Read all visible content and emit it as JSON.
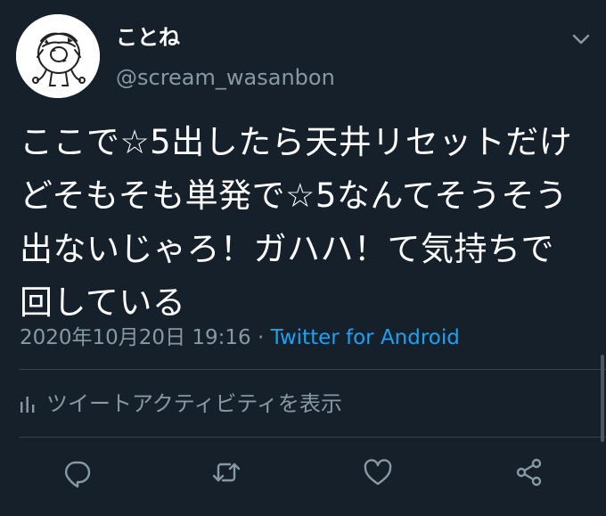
{
  "tweet": {
    "display_name": "ことね",
    "handle": "@scream_wasanbon",
    "text": "ここで☆5出したら天井リセットだけ\nどそもそも単発で☆5なんてそうそう\n出ないじゃろ！ガハハ！て気持ちで\n回している",
    "date": "2020年10月20日 19:16",
    "separator": " · ",
    "source": "Twitter for Android",
    "activity_label": "ツイートアクティビティを表示"
  },
  "icons": {
    "caret": "chevron-down-icon",
    "activity": "bar-chart-icon",
    "reply": "reply-icon",
    "retweet": "retweet-icon",
    "like": "heart-icon",
    "share": "share-icon"
  },
  "colors": {
    "background": "#15202b",
    "primary_text": "#ffffff",
    "secondary_text": "#8899a6",
    "link": "#1da1f2",
    "divider": "#38444d"
  }
}
